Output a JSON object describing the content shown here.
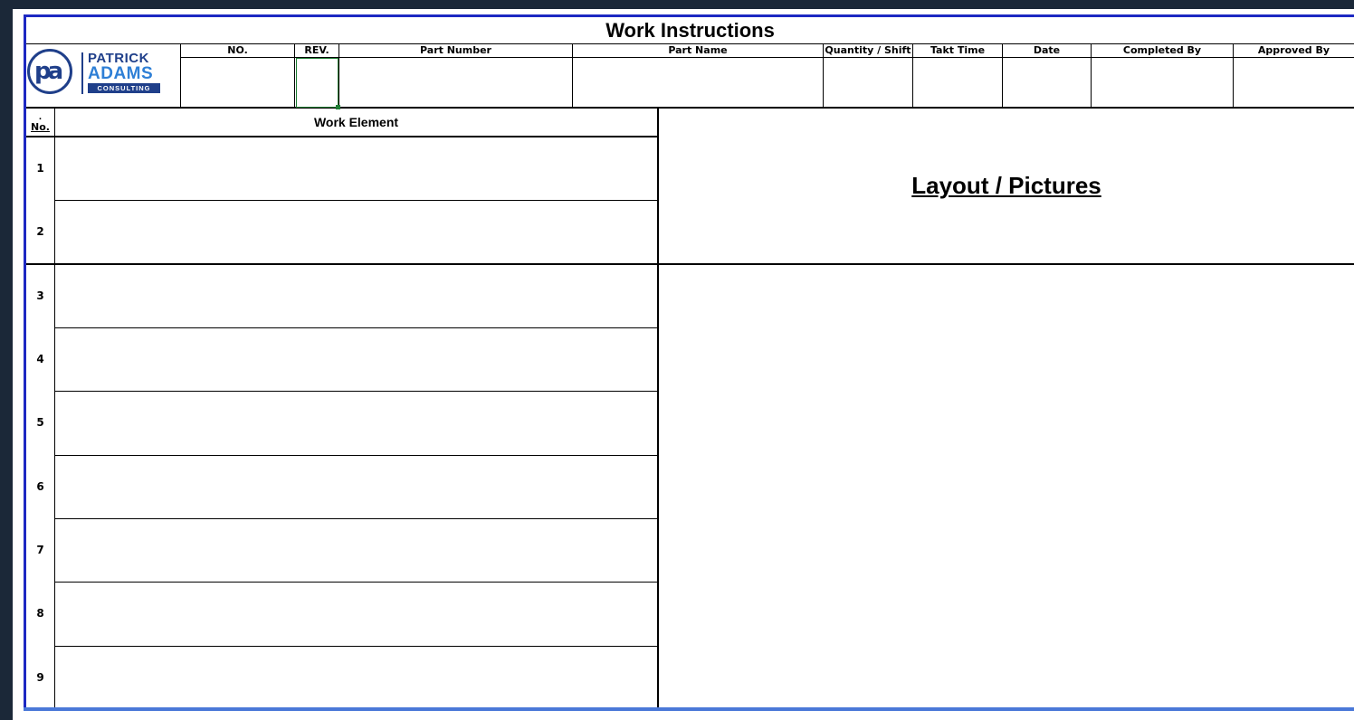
{
  "sheet": {
    "title": "Work Instructions",
    "header_columns": [
      "NO.",
      "REV.",
      "Part Number",
      "Part Name",
      "Quantity / Shift",
      "Takt Time",
      "Date",
      "Completed By",
      "Approved By"
    ],
    "logo": {
      "line1": "PATRICK",
      "line2": "ADAMS",
      "line3": "CONSULTING",
      "monogram": "pa",
      "brand_color": "#1f3f8a",
      "accent_color": "#2e7fd6"
    },
    "table": {
      "no_header": "No.",
      "no_header_mark": ".",
      "work_element_header": "Work Element",
      "rows": [
        "1",
        "2",
        "3",
        "4",
        "5",
        "6",
        "7",
        "8",
        "9"
      ]
    },
    "layout_title": "Layout / Pictures",
    "frame_color": "#1d28c2",
    "selection_color": "#1e7e34"
  }
}
